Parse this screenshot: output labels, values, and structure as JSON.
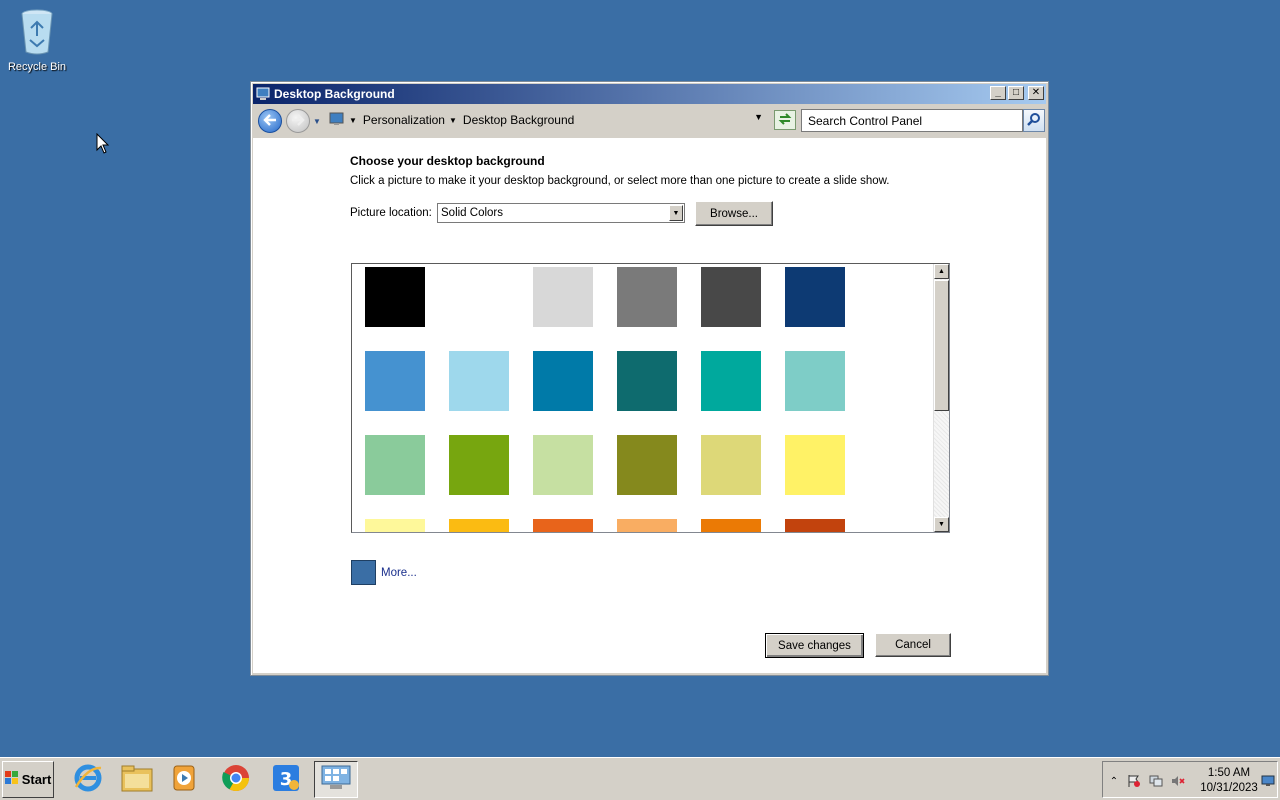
{
  "desktop": {
    "background_color": "#3a6ea5",
    "icons": [
      {
        "label": "Recycle Bin",
        "icon": "recycle-bin-icon"
      }
    ]
  },
  "window": {
    "title": "Desktop Background",
    "controls": {
      "minimize": "minimize-icon",
      "maximize": "maximize-icon",
      "close": "close-icon"
    },
    "nav": {
      "breadcrumbs": [
        "Personalization",
        "Desktop Background"
      ],
      "search_placeholder": "Search Control Panel"
    },
    "content": {
      "heading": "Choose your desktop background",
      "description": "Click a picture to make it your desktop background, or select more than one picture to create a slide show.",
      "picture_location_label": "Picture location:",
      "picture_location_value": "Solid Colors",
      "browse_label": "Browse...",
      "swatches": [
        [
          "#000000",
          "#ffffff",
          "#d8d8d8",
          "#7a7a7a",
          "#484848",
          "#0d3a73"
        ],
        [
          "#4592d0",
          "#9ed8ec",
          "#007aa8",
          "#0e6b6e",
          "#00a99d",
          "#7ecdc7"
        ],
        [
          "#8acb9b",
          "#77a60f",
          "#c6e0a2",
          "#85891d",
          "#ddd878",
          "#fff266"
        ],
        [
          "#fef89a",
          "#fbbb12",
          "#e8641b",
          "#f9ad62",
          "#eb7a05",
          "#c2430d"
        ]
      ],
      "more_label": "More...",
      "more_color": "#3a6ea5",
      "save_label": "Save changes",
      "cancel_label": "Cancel"
    }
  },
  "taskbar": {
    "start_label": "Start",
    "apps": [
      {
        "name": "internet-explorer",
        "icon": "ie-icon"
      },
      {
        "name": "file-explorer",
        "icon": "folder-icon"
      },
      {
        "name": "media-player",
        "icon": "media-player-icon"
      },
      {
        "name": "chrome",
        "icon": "chrome-icon"
      },
      {
        "name": "app",
        "icon": "app-icon"
      },
      {
        "name": "control-panel",
        "icon": "control-panel-icon",
        "active": true
      }
    ],
    "clock": {
      "time": "1:50 AM",
      "date": "10/31/2023"
    }
  }
}
